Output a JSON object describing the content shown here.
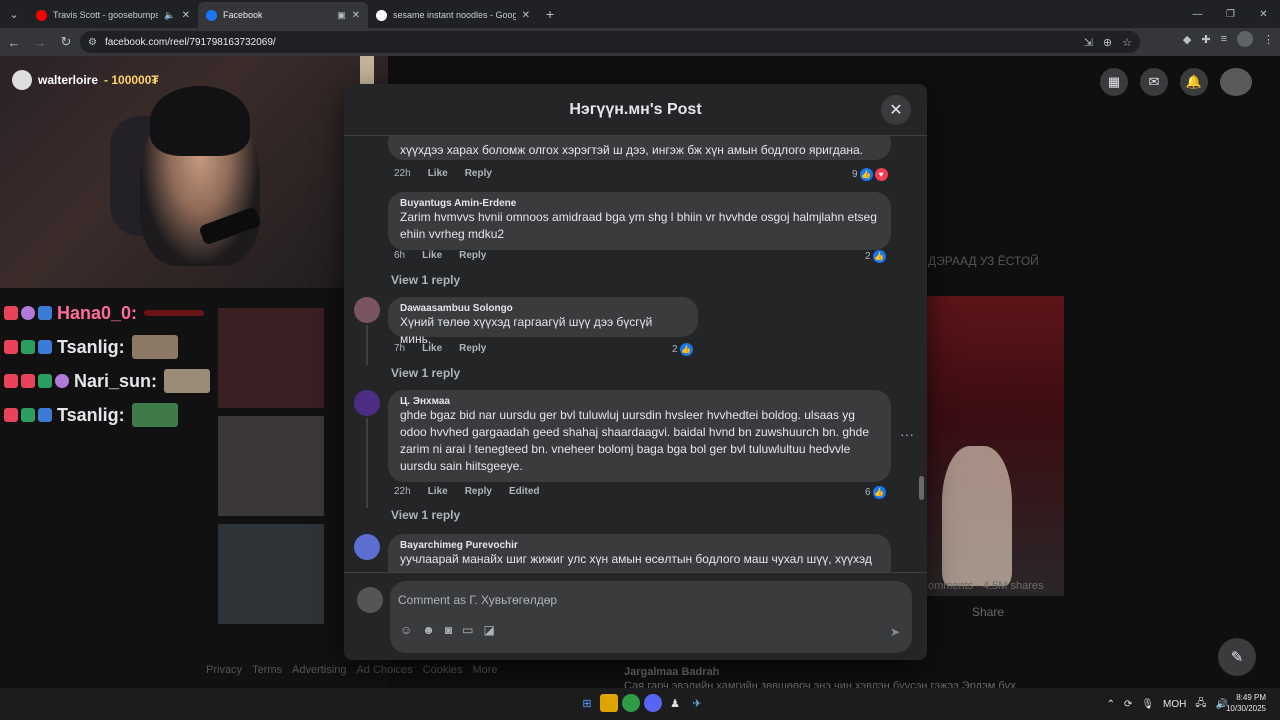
{
  "browser": {
    "tabs": [
      {
        "title": "Travis Scott - goosebumps",
        "favicon_color": "#ff0000",
        "active": false
      },
      {
        "title": "Facebook",
        "favicon_color": "#1877f2",
        "active": true
      },
      {
        "title": "sesame instant noodles - Goog",
        "favicon_color": "#ffffff",
        "active": false
      }
    ],
    "url": "facebook.com/reel/791798163732069/"
  },
  "stream": {
    "streamer": "walterloire",
    "points": "- 100000₮",
    "chat": [
      {
        "name": "Hana0_0:",
        "color": "#ff6b9d"
      },
      {
        "name": "Tsanlig:",
        "color": "#ffffff"
      },
      {
        "name": "Nari_sun:",
        "color": "#ffffff"
      },
      {
        "name": "Tsanlig:",
        "color": "#ffffff"
      }
    ]
  },
  "background": {
    "text_1": "ДЭРААД УЗ ЁСТОЙ",
    "text_2": "omments · 4.5M shares",
    "share": "Share",
    "commenter": "Jargalmaa Badrah",
    "comment_snippet": "Сая гарч эвэлийн хамгийн зөвшөөрч энэ чин хэвлэн бүүсэн гэжээ Эрдэм бүх",
    "footer": [
      "Privacy",
      "Terms",
      "Advertising",
      "Ad Choices",
      "Cookies",
      "More"
    ]
  },
  "modal": {
    "title": "Нэгүүн.мн's Post",
    "comments": [
      {
        "author": "",
        "text": "хүүхдээ харах боломж олгох хэрэгтэй ш дээ, ингэж бж хүн амын бодлого яригдана.",
        "time": "22h",
        "like": "Like",
        "reply": "Reply",
        "count": "9"
      },
      {
        "author": "Buyantugs Amin-Erdene",
        "text": "Zarim hvmvvs hvnii omnoos amidraad bga ym shg l bhiin vr hvvhde osgoj halmjlahn etseg ehiin vvrheg mdku2",
        "time": "6h",
        "like": "Like",
        "reply": "Reply",
        "count": "2",
        "view_reply": "View 1 reply"
      },
      {
        "author": "Dawaasambuu Solongo",
        "text": "Хүний төлөө хүүхэд гаргаагүй шүү дээ бүсгүй минь.",
        "time": "7h",
        "like": "Like",
        "reply": "Reply",
        "count": "2",
        "view_reply": "View 1 reply"
      },
      {
        "author": "Ц. Энхмаа",
        "text": "ghde bgaz bid nar uursdu ger bvl tuluwluj uursdin hvsleer hvvhedtei boldog. ulsaas yg odoo hvvhed gargaadah geed shahaj shaardaagvi. baidal hvnd bn zuwshuurch bn. ghde zarim ni arai l tenegteed bn. vneheer bolomj baga bga bol ger bvl tuluwlultuu hedvvle uursdu sain hiitsgeeye.",
        "time": "22h",
        "like": "Like",
        "reply": "Reply",
        "edited": "Edited",
        "count": "6",
        "view_reply": "View 1 reply"
      },
      {
        "author": "Bayarchimeg Purevochir",
        "text": "уучлаарай манайх шиг жижиг улс хүн амын өсөлтын бодлого маш чухал шүү, хүүхэд"
      }
    ],
    "composer_placeholder": "Comment as Г. Хувьтөгөлдөр"
  },
  "taskbar": {
    "lang": "МОН",
    "time": "8:49 PM",
    "date": "10/30/2025"
  }
}
